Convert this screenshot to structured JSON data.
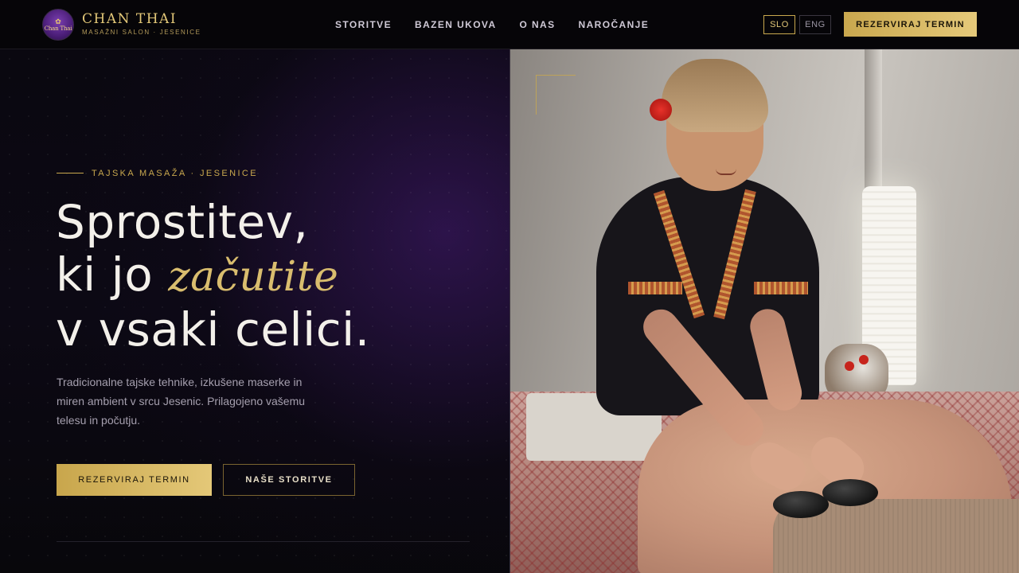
{
  "brand": {
    "logo_text": "Chan Thai",
    "name": "CHAN THAI",
    "tagline": "MASAŽNI SALON · JESENICE"
  },
  "nav": {
    "items": [
      {
        "label": "STORITVE"
      },
      {
        "label": "BAZEN UKOVA"
      },
      {
        "label": "O NAS"
      },
      {
        "label": "NAROČANJE"
      }
    ]
  },
  "language": {
    "options": [
      "SLO",
      "ENG"
    ],
    "active": "SLO"
  },
  "header_cta": "REZERVIRAJ TERMIN",
  "hero": {
    "eyebrow": "TAJSKA MASAŽA · JESENICE",
    "headline_line1": "Sprostitev,",
    "headline_line2_prefix": "ki jo ",
    "headline_line2_accent": "začutite",
    "headline_line3": "v vsaki celici.",
    "lede": "Tradicionalne tajske tehnike, izkušene maserke in miren ambient v srcu Jesenic. Prilagojeno vašemu telesu in počutju.",
    "primary_button": "REZERVIRAJ TERMIN",
    "secondary_button": "NAŠE STORITVE"
  },
  "colors": {
    "gold": "#c9a84e",
    "gold_light": "#e4c878",
    "purple_glow": "#481c78",
    "background": "#07060a"
  },
  "icons": {
    "logo": "lotus-icon"
  }
}
